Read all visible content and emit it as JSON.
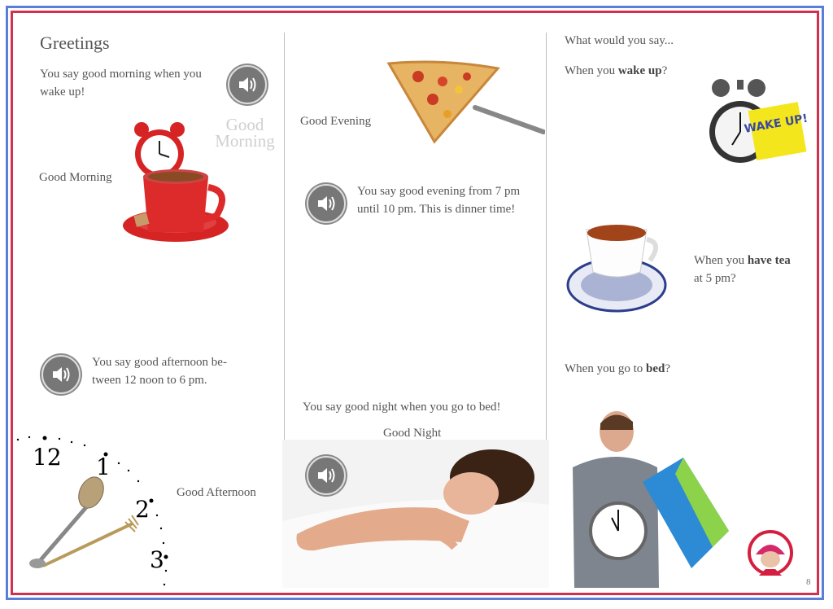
{
  "col1": {
    "title": "Greetings",
    "morning_desc": "You say good morning when you wake up!",
    "morning_label": "Good Morning",
    "morning_ghost": "Good Morning",
    "afternoon_desc": "You say good afternoon be-tween 12 noon to 6 pm.",
    "afternoon_label": "Good Afternoon",
    "clock_numbers": [
      "12",
      "1",
      "2",
      "3"
    ]
  },
  "col2": {
    "evening_label": "Good Evening",
    "evening_desc": "You say good evening from 7 pm until 10 pm. This is dinner time!",
    "night_desc": "You say good night when you go to bed!",
    "night_label": "Good Night"
  },
  "col3": {
    "prompt": "What would you say...",
    "q1_pre": "When you ",
    "q1_bold": "wake up",
    "q1_post": "?",
    "wake_sticker": "WAKE UP!",
    "q2_pre": "When you ",
    "q2_bold": "have tea",
    "q2_post": " at 5 pm?",
    "q3_pre": "When you go to ",
    "q3_bold": "bed",
    "q3_post": "?"
  },
  "page_number": "8",
  "icons": [
    "speaker-icon",
    "alarm-clock-icon",
    "coffee-cup-icon",
    "pizza-slice-icon",
    "tea-cup-icon",
    "clock-face-icon",
    "person-avatar-icon"
  ],
  "colors": {
    "frame_outer": "#5b7fd8",
    "frame_inner": "#d1304f"
  }
}
